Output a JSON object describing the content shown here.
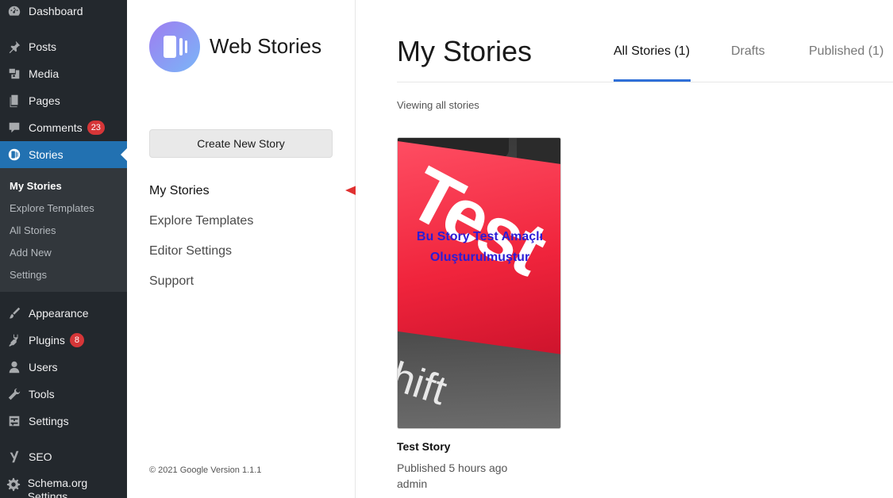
{
  "wp_sidebar": {
    "items": [
      {
        "label": "Dashboard",
        "icon": "dashboard-icon"
      },
      {
        "label": "Posts",
        "icon": "pin-icon"
      },
      {
        "label": "Media",
        "icon": "media-icon"
      },
      {
        "label": "Pages",
        "icon": "pages-icon"
      },
      {
        "label": "Comments",
        "icon": "comment-icon",
        "badge": "23"
      },
      {
        "label": "Stories",
        "icon": "stories-icon"
      },
      {
        "label": "Appearance",
        "icon": "brush-icon"
      },
      {
        "label": "Plugins",
        "icon": "plug-icon",
        "badge": "8"
      },
      {
        "label": "Users",
        "icon": "user-icon"
      },
      {
        "label": "Tools",
        "icon": "wrench-icon"
      },
      {
        "label": "Settings",
        "icon": "sliders-icon"
      },
      {
        "label": "SEO",
        "icon": "yoast-icon"
      },
      {
        "label": "Schema.org Settings",
        "icon": "gear-icon"
      }
    ],
    "submenu": [
      "My Stories",
      "Explore Templates",
      "All Stories",
      "Add New",
      "Settings"
    ],
    "accent_color": "#2271b1"
  },
  "ws_nav": {
    "brand": "Web Stories",
    "create_button": "Create New Story",
    "links": [
      "My Stories",
      "Explore Templates",
      "Editor Settings",
      "Support"
    ],
    "footer": "© 2021 Google Version 1.1.1"
  },
  "main": {
    "heading": "My Stories",
    "tabs": [
      "All Stories (1)",
      "Drafts",
      "Published (1)"
    ],
    "active_tab_color": "#2f6fd8",
    "viewing_label": "Viewing all stories",
    "story": {
      "overlay_text_line1": "Bu Story Test Amaçlı",
      "overlay_text_line2": "Oluşturulmuştur",
      "key_text_1": "Test",
      "key_text_2": "hift",
      "title": "Test Story",
      "status": "Published 5 hours ago",
      "author": "admin"
    }
  }
}
